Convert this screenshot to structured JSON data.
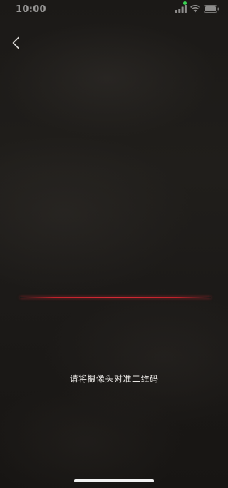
{
  "status_bar": {
    "time": "10:00",
    "icons": [
      "signal-icon",
      "wifi-icon",
      "battery-icon"
    ]
  },
  "nav": {
    "back_icon": "chevron-left-icon"
  },
  "scanner": {
    "hint": "请将摄像头对准二维码",
    "scan_line_color": "#d42a35"
  },
  "colors": {
    "background": "#1c1a18",
    "text": "#e8e6e3",
    "home_indicator": "#f2f2f2"
  }
}
